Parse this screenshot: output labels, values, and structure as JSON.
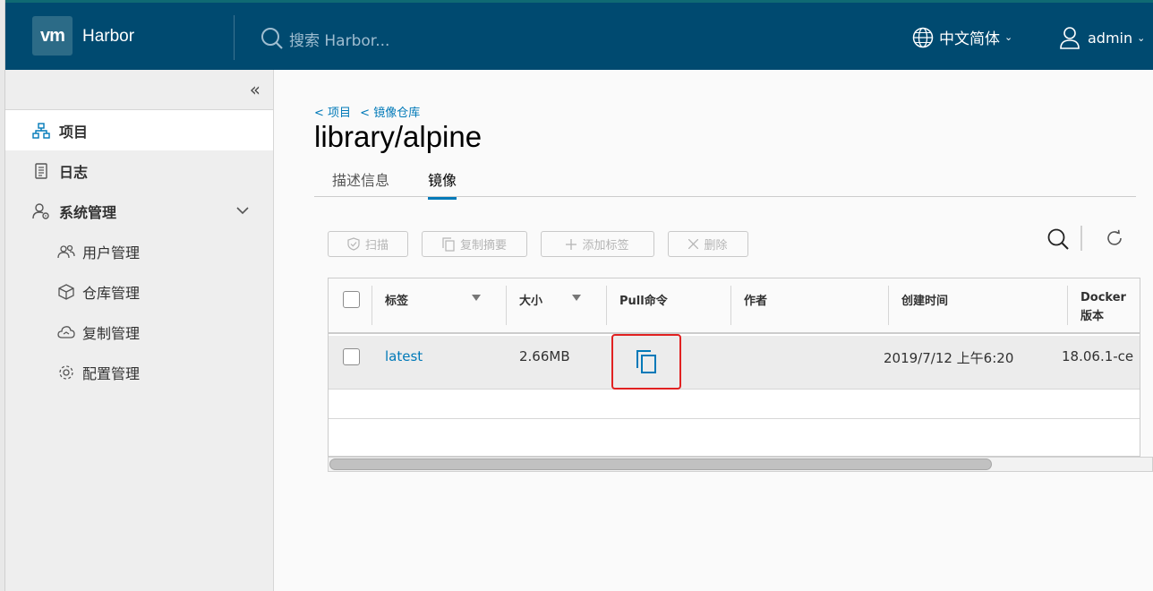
{
  "app": {
    "logo_text": "vm",
    "brand": "Harbor",
    "search_placeholder": "搜索 Harbor...",
    "language": "中文简体",
    "user": "admin",
    "colors": {
      "header": "#004a70",
      "accent": "#0079b8",
      "highlight": "#e12121"
    }
  },
  "sidebar": {
    "collapse_icon": "«",
    "items": [
      {
        "label": "项目",
        "icon": "project-icon",
        "active": true
      },
      {
        "label": "日志",
        "icon": "log-icon",
        "active": false
      },
      {
        "label": "系统管理",
        "icon": "admin-icon",
        "active": false
      }
    ],
    "sub_items": [
      {
        "label": "用户管理",
        "icon": "users-icon"
      },
      {
        "label": "仓库管理",
        "icon": "cube-icon"
      },
      {
        "label": "复制管理",
        "icon": "cloud-sync-icon"
      },
      {
        "label": "配置管理",
        "icon": "cog-icon"
      }
    ]
  },
  "main": {
    "breadcrumb": [
      "< 项目",
      "< 镜像仓库"
    ],
    "title": "library/alpine",
    "tabs": [
      {
        "label": "描述信息",
        "active": false
      },
      {
        "label": "镜像",
        "active": true
      }
    ],
    "toolbar": {
      "scan": "扫描",
      "copy_digest": "复制摘要",
      "add_label": "添加标签",
      "delete": "删除"
    },
    "table": {
      "columns": [
        "标签",
        "大小",
        "Pull命令",
        "作者",
        "创建时间",
        "Docker",
        "版本"
      ],
      "rows": [
        {
          "tag": "latest",
          "size": "2.66MB",
          "pull_icon": "copy-icon",
          "author": "",
          "created": "2019/7/12 上午6:20",
          "docker_version": "18.06.1-ce"
        }
      ]
    }
  }
}
